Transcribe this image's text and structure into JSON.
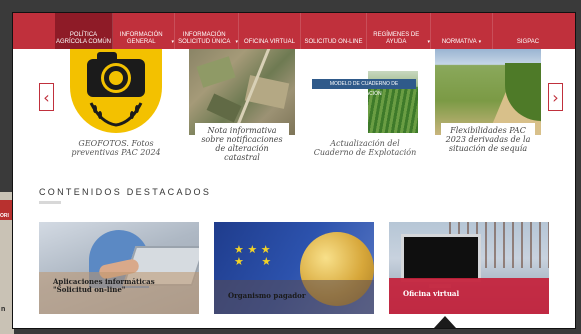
{
  "background": {
    "badge_text": "ORI",
    "edge_text": "n"
  },
  "nav": {
    "items": [
      {
        "label": "POLÍTICA AGRÍCOLA COMÚN",
        "active": true,
        "caret": false
      },
      {
        "label": "INFORMACIÓN GENERAL",
        "active": false,
        "caret": true
      },
      {
        "label": "INFORMACIÓN SOLICITUD ÚNICA",
        "active": false,
        "caret": true
      },
      {
        "label": "OFICINA VIRTUAL",
        "active": false,
        "caret": false
      },
      {
        "label": "SOLICITUD ON-LINE",
        "active": false,
        "caret": false
      },
      {
        "label": "REGÍMENES DE AYUDA",
        "active": false,
        "caret": true
      },
      {
        "label": "NORMATIVA",
        "active": false,
        "caret": true
      },
      {
        "label": "SIGPAC",
        "active": false,
        "caret": false
      }
    ]
  },
  "carousel": {
    "prev_icon": "‹",
    "next_icon": "›",
    "cards": [
      {
        "caption": "GEOFOTOS. Fotos preventivas PAC 2024"
      },
      {
        "caption": "Nota informativa sobre notificaciones de alteración catastral"
      },
      {
        "tag": "MODELO DE CUADERNO DE EXPLOTACIÓN",
        "caption": "Actualización del Cuaderno de Explotación"
      },
      {
        "caption": "Flexibilidades PAC 2023 derivadas de la situación de sequía"
      }
    ]
  },
  "featured": {
    "title": "CONTENIDOS DESTACADOS",
    "tiles": [
      {
        "label": "Aplicaciones informáticas \"Solicitud on-line\""
      },
      {
        "label": "Organismo pagador"
      },
      {
        "label": "Oficina virtual"
      }
    ]
  },
  "colors": {
    "brand_red": "#c0303c",
    "active_nav": "#8e1b27",
    "geofotos_yellow": "#f3c100"
  }
}
